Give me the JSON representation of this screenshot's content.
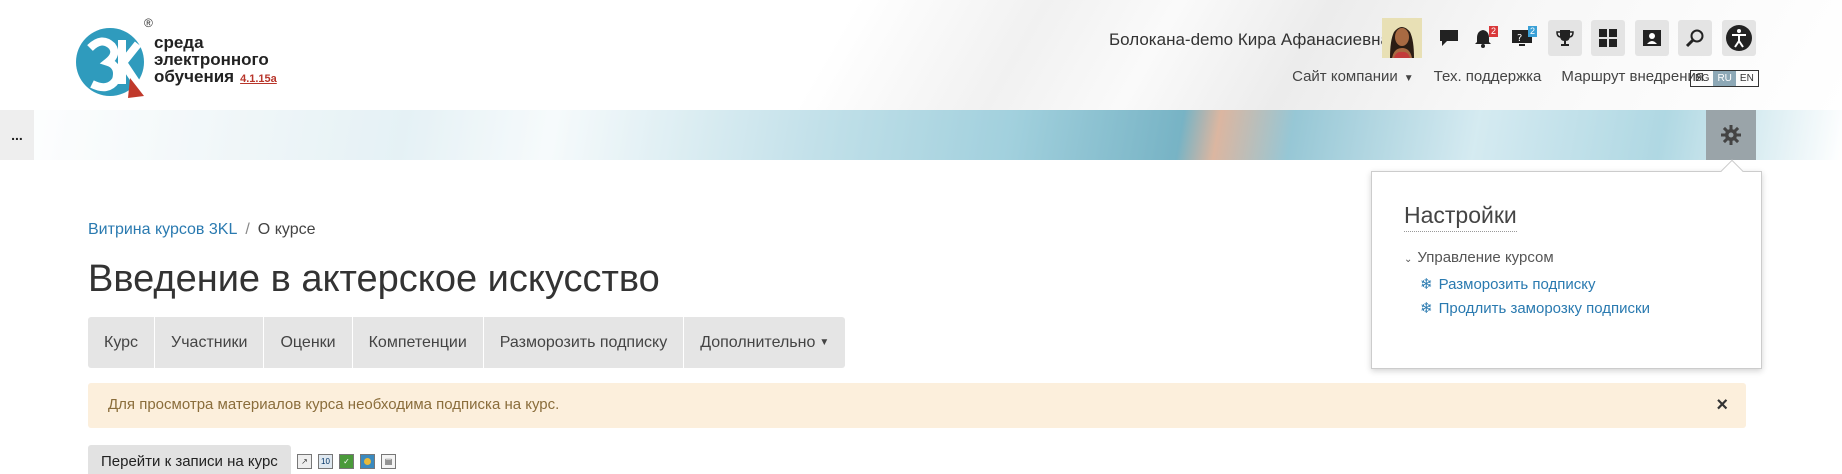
{
  "logo": {
    "line1": "среда",
    "line2": "электронного",
    "line3": "обучения",
    "version": "4.1.15a",
    "registered": "®"
  },
  "header": {
    "user_name": "Болокана-demo Кира Афанасиевна",
    "notifications_count": "2",
    "help_count": "2",
    "links": [
      "Сайт компании",
      "Тех. поддержка",
      "Маршрут внедрения"
    ],
    "languages": [
      "BG",
      "RU",
      "EN"
    ],
    "active_language": "RU"
  },
  "drawer": {
    "label": "..."
  },
  "breadcrumb": {
    "root": "Витрина курсов 3KL",
    "separator": "/",
    "current": "О курсе"
  },
  "page": {
    "title": "Введение в актерское искусство"
  },
  "tabs": [
    "Курс",
    "Участники",
    "Оценки",
    "Компетенции",
    "Разморозить подписку",
    "Дополнительно"
  ],
  "alert": {
    "text": "Для просмотра материалов курса необходима подписка на курс.",
    "close": "×"
  },
  "enroll": {
    "label": "Перейти к записи на курс"
  },
  "settings": {
    "title": "Настройки",
    "section": "Управление курсом",
    "items": [
      "Разморозить подписку",
      "Продлить заморозку подписки"
    ]
  },
  "colors": {
    "link": "#2a7ab0",
    "alert_bg": "#fcefdc",
    "alert_text": "#8a6d3b",
    "badge_red": "#d9383a",
    "badge_blue": "#3aa0d6"
  }
}
